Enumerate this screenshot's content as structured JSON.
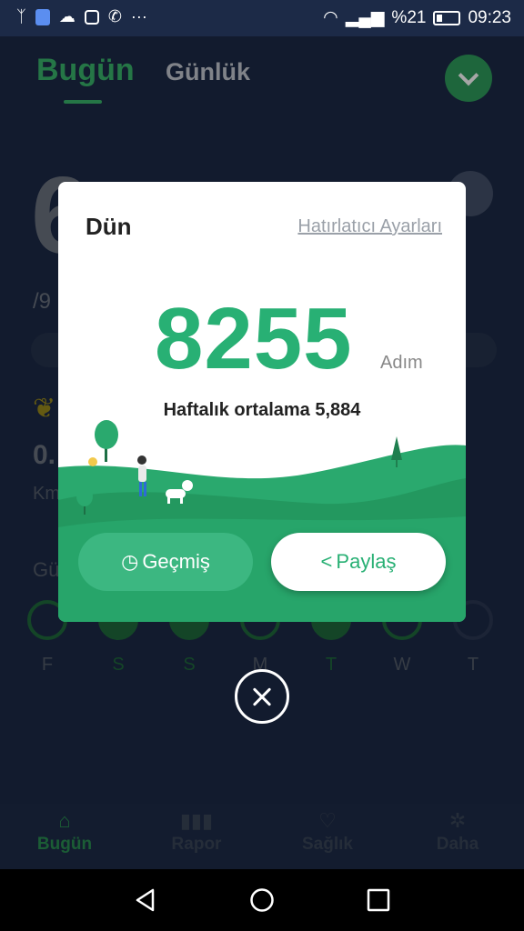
{
  "status_bar": {
    "battery": "%21",
    "time": "09:23",
    "left_icons": [
      "activity-icon",
      "shield-icon",
      "cloud-icon",
      "instagram-icon",
      "whatsapp-icon",
      "more-icon"
    ],
    "right_icons": [
      "wifi-icon",
      "signal-icon",
      "battery-icon"
    ]
  },
  "header": {
    "tabs": [
      {
        "label": "Bugün",
        "active": true
      },
      {
        "label": "Günlük",
        "active": false
      }
    ]
  },
  "background": {
    "big_partial": "6",
    "slash_partial": "/9",
    "distance_partial": "0.",
    "km_partial": "Km",
    "section_partial": "Gü",
    "week_days": [
      "F",
      "S",
      "S",
      "M",
      "T",
      "W",
      "T"
    ]
  },
  "dialog": {
    "title": "Dün",
    "reminder_link": "Hatırlatıcı Ayarları",
    "steps": "8255",
    "steps_unit": "Adım",
    "weekly_average": "Haftalık ortalama 5,884",
    "history_button": "Geçmiş",
    "share_button": "Paylaş"
  },
  "bottom_nav": [
    {
      "label": "Bugün",
      "icon": "home-icon",
      "active": true
    },
    {
      "label": "Rapor",
      "icon": "bar-chart-icon",
      "active": false
    },
    {
      "label": "Sağlık",
      "icon": "heart-icon",
      "active": false
    },
    {
      "label": "Daha",
      "icon": "gear-icon",
      "active": false
    }
  ],
  "colors": {
    "accent": "#28b074",
    "background": "#1c2a47"
  }
}
